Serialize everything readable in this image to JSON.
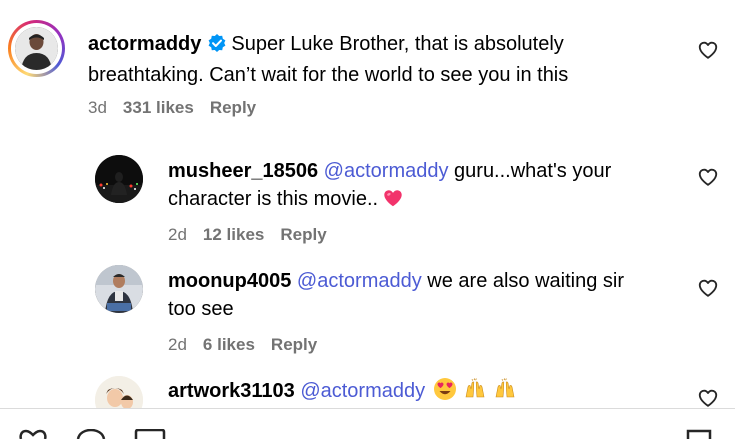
{
  "comments": [
    {
      "username": "actormaddy",
      "verified": true,
      "mention": "",
      "line1": "Super Luke Brother, that is absolutely",
      "line2": "breathtaking. Can’t wait for the world to see you in this",
      "age": "3d",
      "likes": "331 likes",
      "reply": "Reply"
    },
    {
      "username": "musheer_18506",
      "mention": "@actormaddy",
      "line1": "guru...what's your",
      "line2": "character is this movie..",
      "age": "2d",
      "likes": "12 likes",
      "reply": "Reply"
    },
    {
      "username": "moonup4005",
      "mention": "@actormaddy",
      "line1": "we are also waiting sir",
      "line2": "too see",
      "age": "2d",
      "likes": "6 likes",
      "reply": "Reply"
    },
    {
      "username": "artwork31103",
      "mention": "@actormaddy",
      "line1": "",
      "line2": ""
    }
  ],
  "icons": {
    "like": "heart-outline-icon",
    "verified": "verified-badge-icon",
    "heart_emoji": "pink-heart-emoji",
    "heart_eyes_emoji": "heart-eyes-emoji",
    "raised_hands_emoji": "raised-hands-emoji"
  },
  "colors": {
    "mention": "#4c5bd4",
    "meta": "#737373",
    "verified": "#0095f6"
  }
}
